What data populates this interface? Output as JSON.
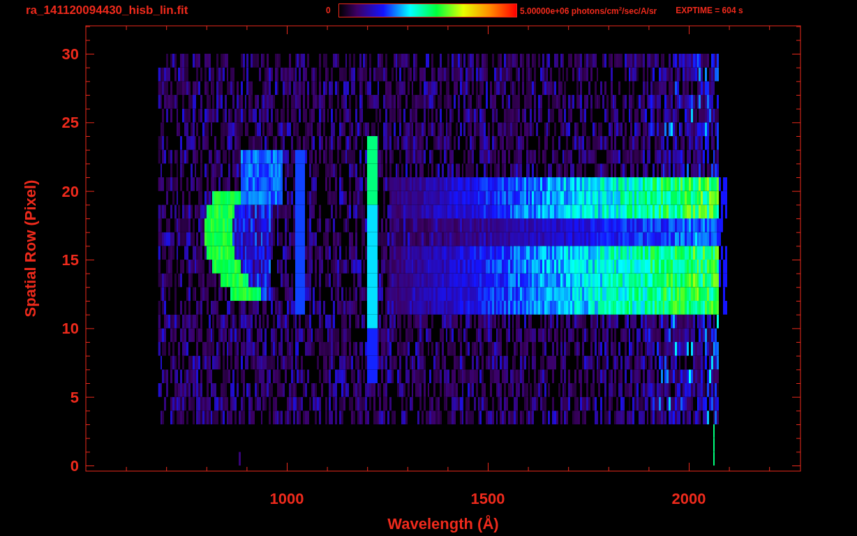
{
  "header": {
    "title": "ra_141120094430_hisb_lin.fit",
    "colorbar_min": "0",
    "colorbar_max": "5.00000e+06 photons/cm$^{2}$/sec/A/sr",
    "exptime": "EXPTIME = 604 s"
  },
  "plot": {
    "xlabel": "Wavelength (Å)",
    "ylabel": "Spatial Row (Pixel)",
    "xtick_labels": [
      "1000",
      "1500",
      "2000"
    ],
    "ytick_labels": [
      "30",
      "25",
      "20",
      "15",
      "10",
      "5",
      "0"
    ]
  }
}
